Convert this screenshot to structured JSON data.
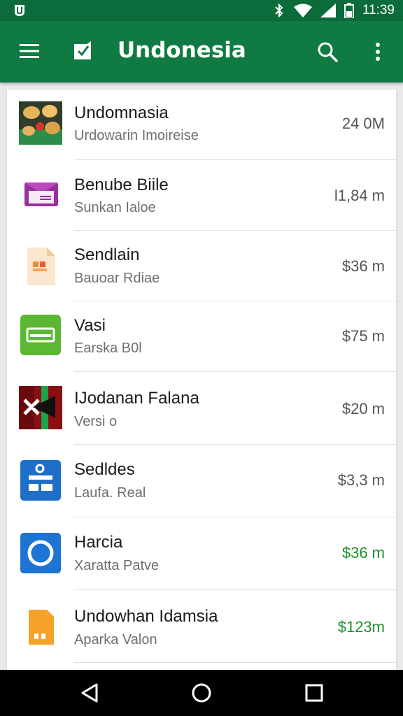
{
  "status_bar": {
    "time": "11:39",
    "icons": [
      "app-notification-icon",
      "bluetooth-icon",
      "wifi-icon",
      "signal-icon",
      "battery-icon"
    ]
  },
  "app_bar": {
    "title": "Undonesia",
    "icons": [
      "menu-icon",
      "app-logo-icon",
      "search-icon",
      "more-vert-icon"
    ]
  },
  "list": [
    {
      "name": "Undomnasia",
      "subtitle": "Urdowarin Imoireise",
      "amount": "24 0M",
      "amount_color": "#555555",
      "icon": "food-image-icon"
    },
    {
      "name": "Benube Biile",
      "subtitle": "Sunkan Ialoe",
      "amount": "l1,84 m",
      "amount_color": "#555555",
      "icon": "envelope-icon"
    },
    {
      "name": "Sendlain",
      "subtitle": "Bauoar Rdiae",
      "amount": "$36 m",
      "amount_color": "#555555",
      "icon": "document-icon"
    },
    {
      "name": "Vasi",
      "subtitle": "Earska B0l",
      "amount": "$75 m",
      "amount_color": "#555555",
      "icon": "card-icon"
    },
    {
      "name": "IJodanan Falana",
      "subtitle": "Versi o",
      "amount": "$20 m",
      "amount_color": "#555555",
      "icon": "flag-icon"
    },
    {
      "name": "Sedldes",
      "subtitle": "Laufa. Real",
      "amount": "$3,3 m",
      "amount_color": "#555555",
      "icon": "form-icon"
    },
    {
      "name": "Harcia",
      "subtitle": "Xaratta Patve",
      "amount": "$36 m",
      "amount_color": "#1e8f2e",
      "icon": "circle-icon"
    },
    {
      "name": "Undowhan Idamsia",
      "subtitle": "Aparka Valon",
      "amount": "$123m",
      "amount_color": "#1e8f2e",
      "icon": "sim-card-icon"
    }
  ],
  "nav_bar": {
    "icons": [
      "back-icon",
      "home-icon",
      "recents-icon"
    ]
  },
  "colors": {
    "status_bar": "#0c6b3a",
    "app_bar": "#0f7a42",
    "green_amount": "#1e8f2e"
  }
}
